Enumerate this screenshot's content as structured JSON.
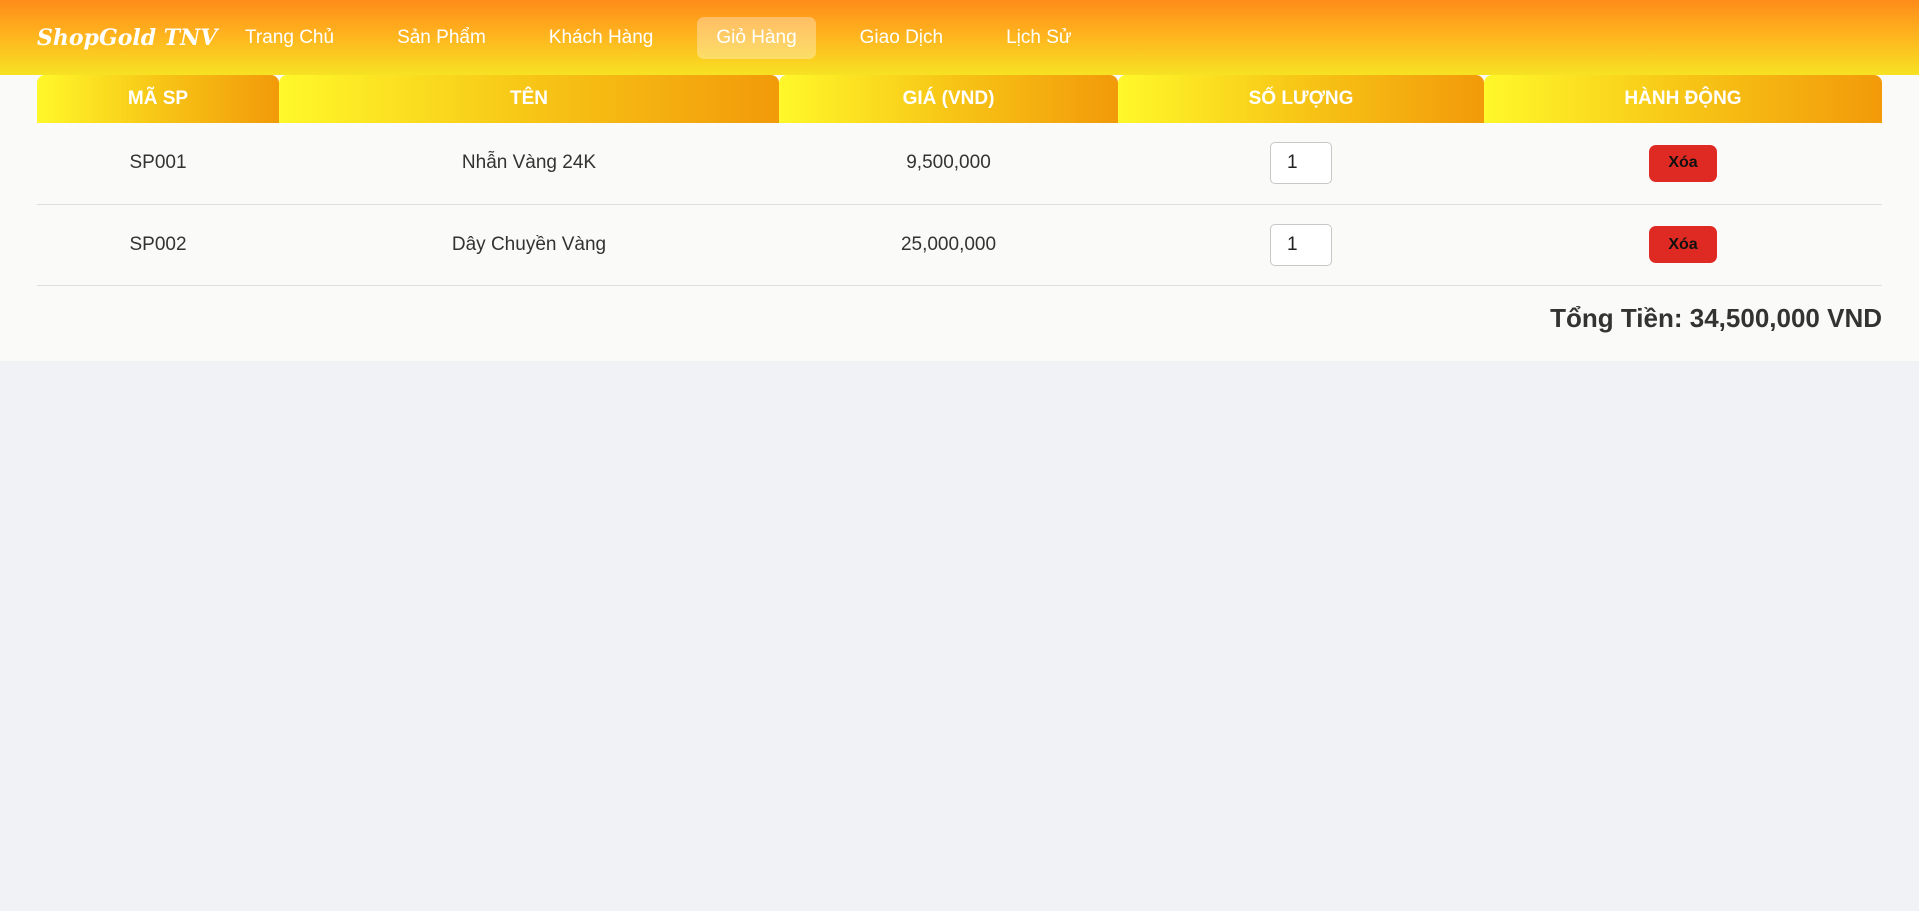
{
  "brand": "ShopGold TNV",
  "nav": {
    "items": [
      {
        "label": "Trang Chủ"
      },
      {
        "label": "Sản Phẩm"
      },
      {
        "label": "Khách Hàng"
      },
      {
        "label": "Giỏ Hàng",
        "active": true
      },
      {
        "label": "Giao Dịch"
      },
      {
        "label": "Lịch Sử"
      }
    ]
  },
  "cart": {
    "columns": [
      "MÃ SP",
      "TÊN",
      "GIÁ (VND)",
      "SỐ LƯỢNG",
      "HÀNH ĐỘNG"
    ],
    "rows": [
      {
        "code": "SP001",
        "name": "Nhẫn Vàng 24K",
        "price": "9,500,000",
        "quantity": "1",
        "action_label": "Xóa"
      },
      {
        "code": "SP002",
        "name": "Dây Chuyền Vàng",
        "price": "25,000,000",
        "quantity": "1",
        "action_label": "Xóa"
      }
    ],
    "total_text": "Tổng Tiền: 34,500,000 VND"
  },
  "colors": {
    "nav_gradient_top": "#ff8c1a",
    "nav_gradient_bottom": "#f7e223",
    "header_gradient_start": "#fff82a",
    "header_gradient_end": "#f29a0a",
    "delete_button": "#de2a22",
    "page_background": "#f0f2f5"
  }
}
